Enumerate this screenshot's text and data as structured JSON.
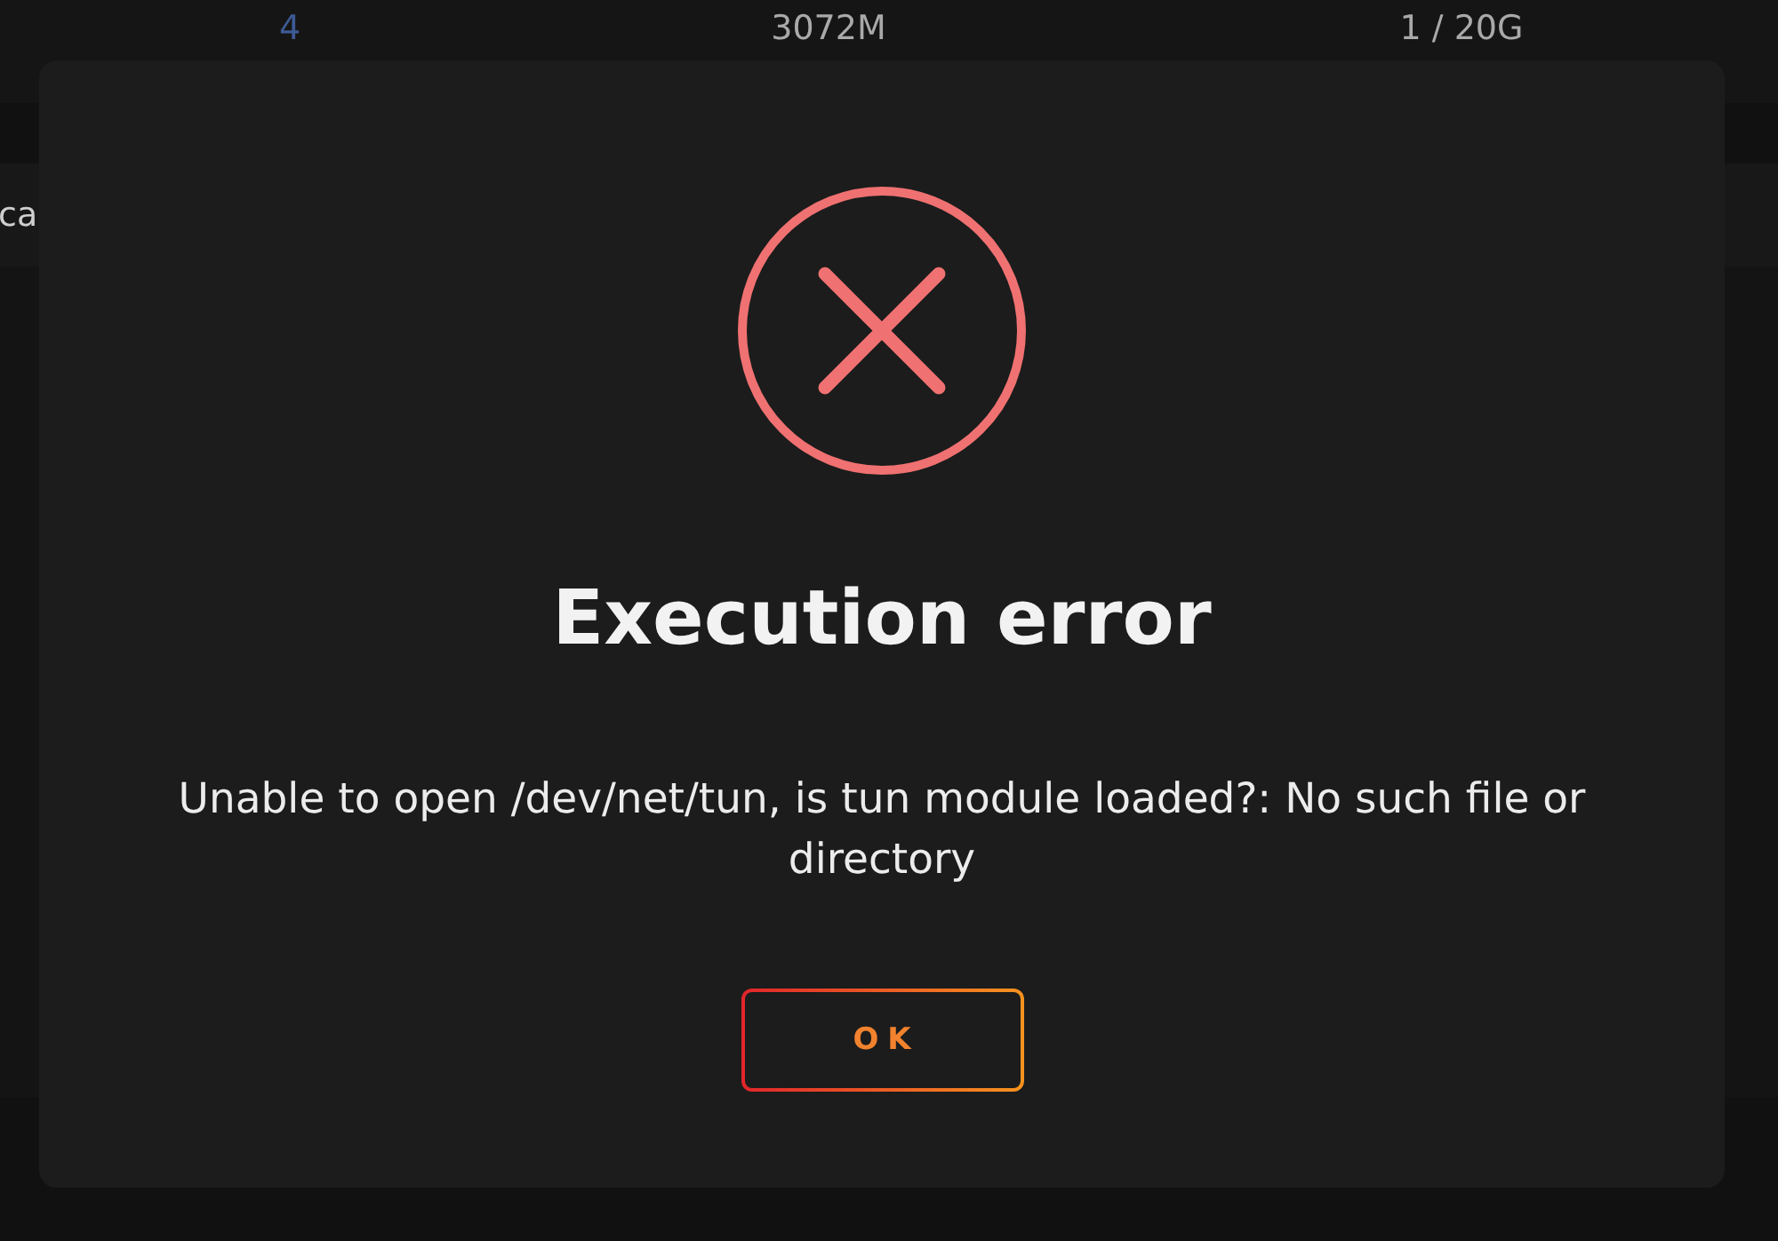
{
  "background": {
    "table_row": [
      {
        "kind": "link",
        "text": "4"
      },
      {
        "kind": "text",
        "text": "3072M"
      },
      {
        "kind": "text",
        "text": "1 / 20G"
      }
    ],
    "cut_text": "ca"
  },
  "dialog": {
    "title": "Execution error",
    "message": "Unable to open /dev/net/tun, is tun module loaded?: No such file or directory",
    "buttons": [
      {
        "label": "OK"
      }
    ]
  }
}
